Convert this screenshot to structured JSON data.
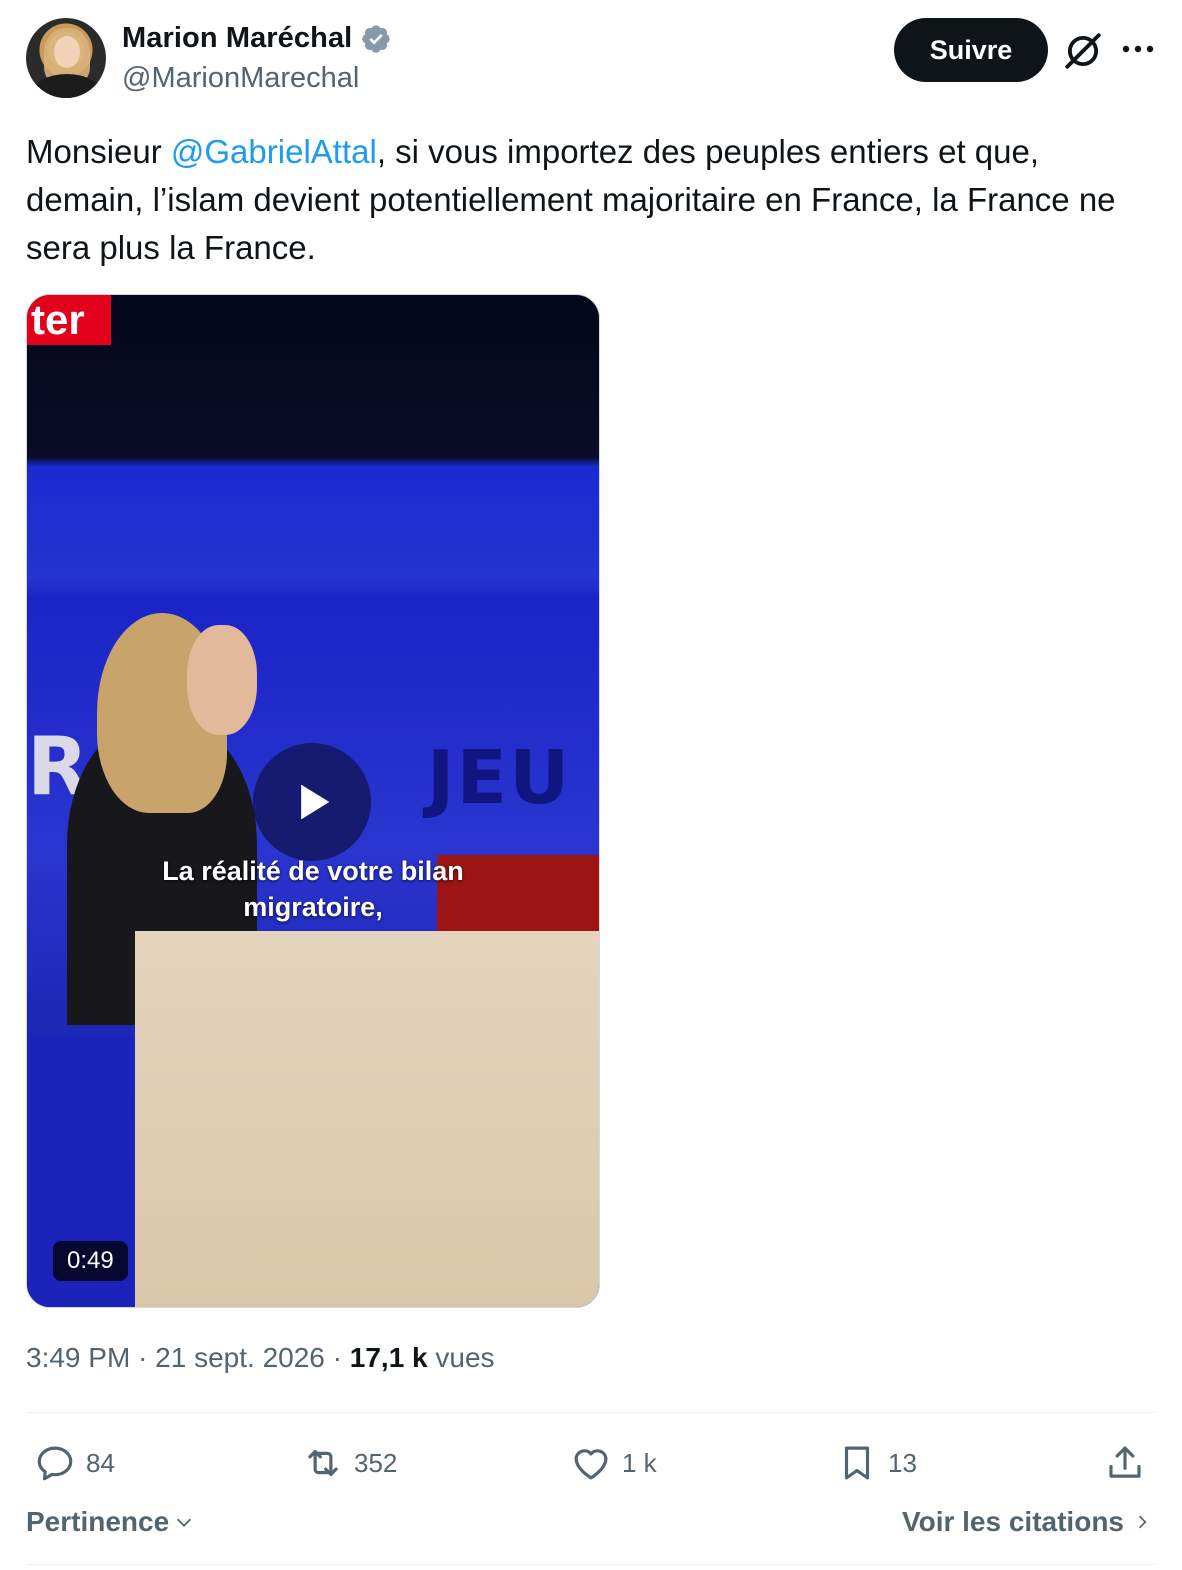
{
  "author": {
    "name": "Marion Maréchal",
    "handle": "@MarionMarechal",
    "verified_icon": "verified-badge-icon"
  },
  "header": {
    "follow_label": "Suivre",
    "grok_icon": "grok-icon",
    "more_icon": "more-icon"
  },
  "tweet": {
    "text_before": "Monsieur ",
    "mention": "@GabrielAttal",
    "text_after": ", si vous importez des peuples entiers et que, demain, l’islam devient potentiellement majoritaire en France, la France ne sera plus la France."
  },
  "video": {
    "logo_text": "ter",
    "caption_line1": "La réalité de votre bilan",
    "caption_line2": "migratoire,",
    "duration": "0:49",
    "backdrop_text_left": "RA",
    "backdrop_text_right": "JEU"
  },
  "meta": {
    "time": "3:49 PM",
    "separator": "·",
    "date": "21 sept. 2026",
    "views_count": "17,1 k",
    "views_label": "vues"
  },
  "actions": {
    "replies": "84",
    "reposts": "352",
    "likes": "1 k",
    "bookmarks": "13"
  },
  "footer": {
    "sort_label": "Pertinence",
    "quotes_label": "Voir les citations"
  },
  "colors": {
    "accent": "#1d9bf0",
    "text": "#0f1419",
    "secondary": "#536471"
  }
}
